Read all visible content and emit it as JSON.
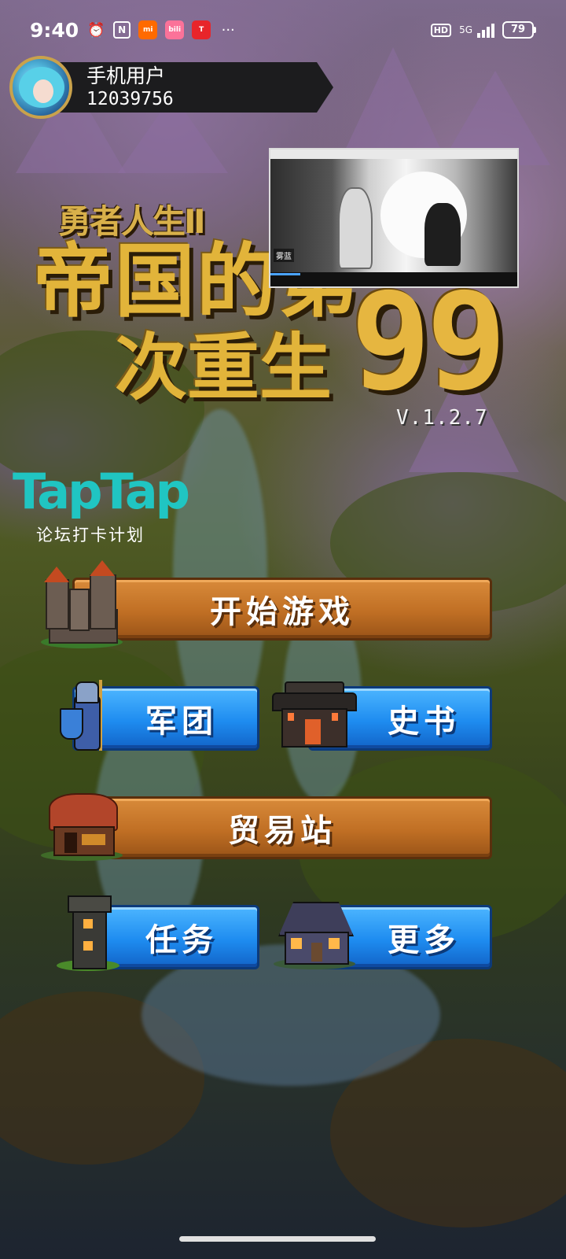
{
  "status_bar": {
    "time": "9:40",
    "icons": [
      "alarm-icon",
      "nfc-icon",
      "mi-app-icon",
      "bilibili-app-icon",
      "tmall-app-icon",
      "more-icon"
    ],
    "more": "···",
    "hd": "HD",
    "network": "5G",
    "battery": "79"
  },
  "profile": {
    "name": "手机用户",
    "id": "12039756"
  },
  "game_title": {
    "subtitle": "勇者人生Ⅱ",
    "line1": "帝国的第",
    "line2": "次重生",
    "number": "99",
    "version": "V.1.2.7"
  },
  "video_overlay": {
    "caption": "雾蓝",
    "progress": 0.12
  },
  "taptap": {
    "logo": "TapTap",
    "subtitle": "论坛打卡计划"
  },
  "menu": {
    "start": "开始游戏",
    "legion": "军团",
    "history": "史书",
    "trade": "贸易站",
    "quest": "任务",
    "more": "更多"
  },
  "colors": {
    "orange_button": "#c06f24",
    "blue_button": "#1e8cf0",
    "title_gold": "#e2b43a",
    "taptap": "#20c5c2"
  }
}
